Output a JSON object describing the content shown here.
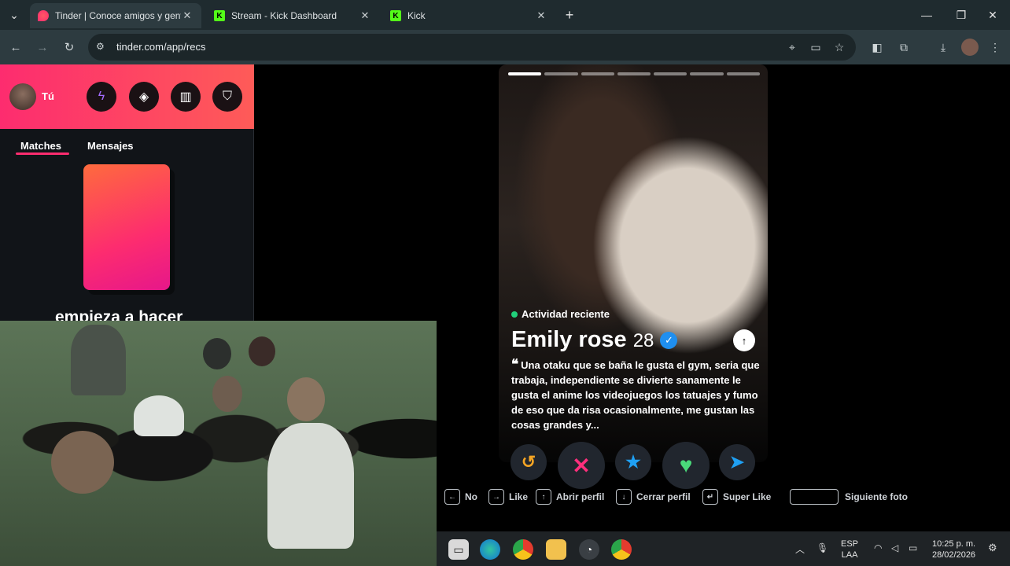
{
  "browser": {
    "tabs": [
      {
        "title": "Tinder | Conoce amigos y gente",
        "active": true
      },
      {
        "title": "Stream - Kick Dashboard",
        "active": false
      },
      {
        "title": "Kick",
        "active": false
      }
    ],
    "new_tab_glyph": "+",
    "url": "tinder.com/app/recs"
  },
  "sidebar": {
    "user_name": "Tú",
    "tabs": [
      {
        "label": "Matches"
      },
      {
        "label": "Mensajes"
      }
    ],
    "empty_state_text": "empieza a hacer"
  },
  "profile": {
    "activity": "Actividad reciente",
    "name": "Emily rose",
    "age": "28",
    "bio": "Una otaku que se baña le gusta el gym, seria que trabaja, independiente se divierte sanamente le gusta el anime los videojuegos los tatuajes y fumo de eso que da risa ocasionalmente, me gustan las cosas grandes y...",
    "photo_count": 7,
    "current_photo": 1
  },
  "actions": [
    {
      "name": "rewind-button",
      "icon": "rewind-icon",
      "glyph": "↺",
      "color": "#f5a524"
    },
    {
      "name": "nope-button",
      "icon": "close-icon",
      "glyph": "✕",
      "color": "#fe2f7c"
    },
    {
      "name": "super-like-button",
      "icon": "star-icon",
      "glyph": "★",
      "color": "#1fa0f3"
    },
    {
      "name": "like-button",
      "icon": "heart-icon",
      "glyph": "♥",
      "color": "#4ad97a"
    },
    {
      "name": "boost-button",
      "icon": "send-icon",
      "glyph": "➤",
      "color": "#1fa0f3"
    }
  ],
  "hints": [
    {
      "key": "←",
      "label": "No"
    },
    {
      "key": "→",
      "label": "Like"
    },
    {
      "key": "↑",
      "label": "Abrir perfil"
    },
    {
      "key": "↓",
      "label": "Cerrar perfil"
    },
    {
      "key": "↵",
      "label": "Super Like"
    },
    {
      "key": "",
      "label": "Siguiente foto"
    }
  ],
  "taskbar": {
    "lang_top": "ESP",
    "lang_bottom": "LAA",
    "time": "10:25 p. m.",
    "date": "28/02/2026"
  }
}
